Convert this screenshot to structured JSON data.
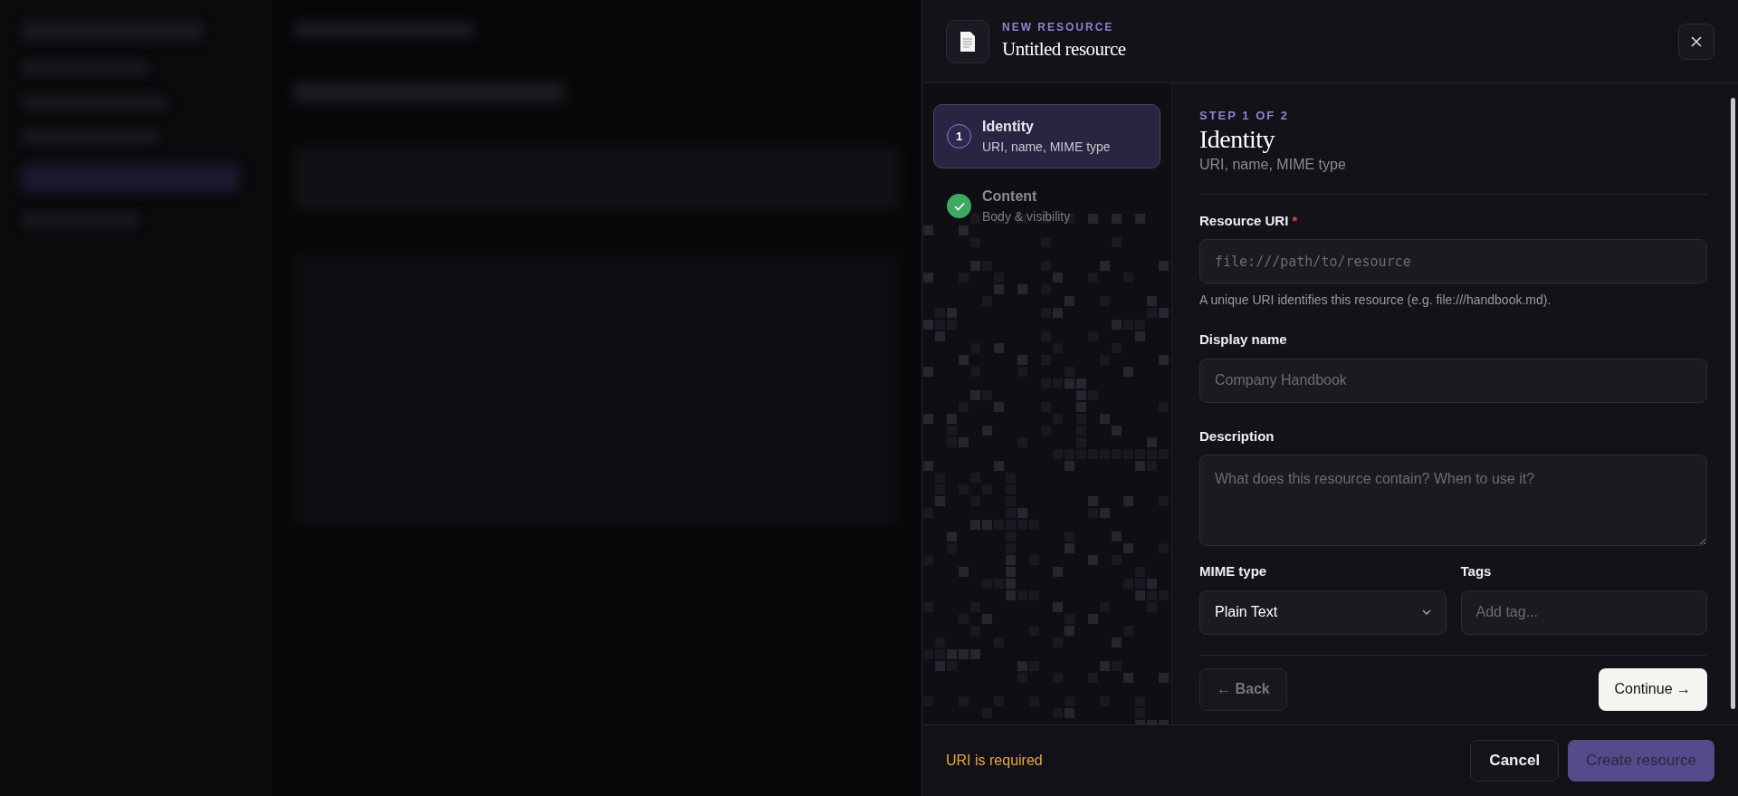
{
  "drawer": {
    "eyebrow": "NEW RESOURCE",
    "title": "Untitled resource"
  },
  "steps": [
    {
      "number": "1",
      "title": "Identity",
      "subtitle": "URI, name, MIME type",
      "selected": true,
      "done": false
    },
    {
      "title": "Content",
      "subtitle": "Body & visibility",
      "selected": false,
      "done": true
    }
  ],
  "step_panel": {
    "step_label": "STEP 1 OF 2",
    "heading": "Identity",
    "subheading": "URI, name, MIME type"
  },
  "fields": [
    {
      "kind": "text",
      "label": "Resource URI",
      "required_mark": "*",
      "monospace": true,
      "placeholder": "file:///path/to/resource",
      "help": "A unique URI identifies this resource (e.g. file:///handbook.md)."
    },
    {
      "kind": "text",
      "label": "Display name",
      "monospace": false,
      "placeholder": "Company Handbook"
    },
    {
      "kind": "textarea",
      "label": "Description",
      "monospace": false,
      "placeholder": "What does this resource contain? When to use it?"
    }
  ],
  "row_fields": [
    {
      "kind": "select",
      "label": "MIME type",
      "value": "Plain Text"
    },
    {
      "kind": "tags",
      "label": "Tags",
      "placeholder": "Add tag..."
    }
  ],
  "nav": {
    "back": "← Back",
    "continue": "Continue →"
  },
  "footer": {
    "message": "URI is required",
    "cancel": "Cancel",
    "create": "Create resource",
    "create_disabled": true
  }
}
